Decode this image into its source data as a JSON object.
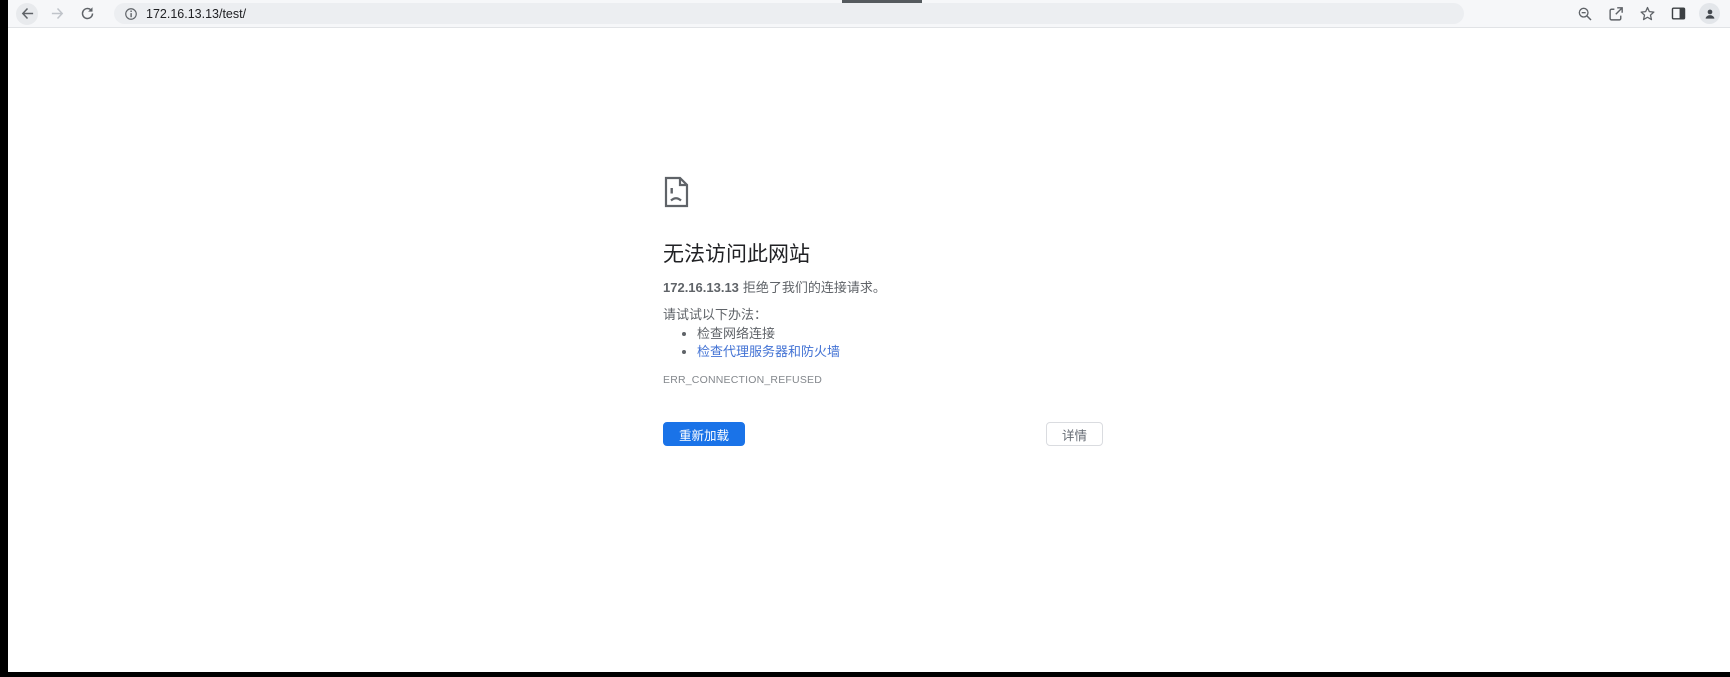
{
  "toolbar": {
    "url": "172.16.13.13/test/",
    "icons": [
      "back-icon",
      "forward-icon",
      "reload-icon",
      "site-info-icon",
      "zoom-out-icon",
      "share-icon",
      "bookmark-star-icon",
      "side-panel-icon",
      "profile-avatar-icon"
    ]
  },
  "error_page": {
    "title": "无法访问此网站",
    "message": {
      "host": "172.16.13.13",
      "text": "拒绝了我们的连接请求。"
    },
    "suggestions_heading": "请试试以下办法：",
    "suggestions": [
      {
        "label": "检查网络连接",
        "is_link": false
      },
      {
        "label": "检查代理服务器和防火墙",
        "is_link": true
      }
    ],
    "error_code": "ERR_CONNECTION_REFUSED",
    "buttons": {
      "reload": "重新加载",
      "details": "详情"
    }
  },
  "colors": {
    "primary_button": "#1a73e8",
    "link_blue": "#4272d4",
    "title_text": "#202124",
    "body_text": "#5f6368",
    "toolbar_bg": "#f6f7f9",
    "omnibox_bg": "#eceef1"
  }
}
